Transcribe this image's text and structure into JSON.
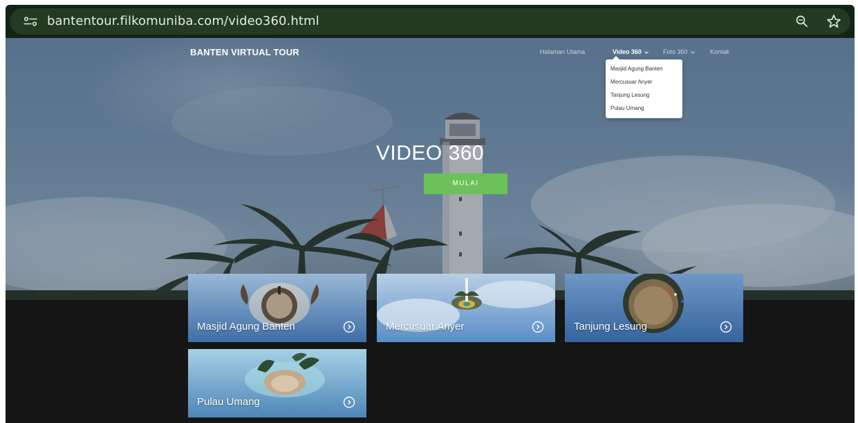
{
  "browser": {
    "url": "bantentour.filkomuniba.com/video360.html",
    "icons": [
      "site-settings-icon",
      "zoom-out-icon",
      "bookmark-star-icon"
    ]
  },
  "navbar": {
    "brand": "BANTEN VIRTUAL TOUR",
    "items": [
      {
        "label": "Halaman Utama"
      },
      {
        "label": "Video 360",
        "active": true,
        "has_dropdown": true
      },
      {
        "label": "Foto 360",
        "has_dropdown": true
      },
      {
        "label": "Kontak"
      }
    ]
  },
  "dropdown": {
    "items": [
      "Masjid Agung Banten",
      "Mercusuar Anyer",
      "Tanjung Lesung",
      "Pulau Umang"
    ]
  },
  "hero": {
    "title": "VIDEO 360",
    "button": "MULAI"
  },
  "cards": [
    {
      "label": "Masjid Agung Banten",
      "icon": "play-circle-icon"
    },
    {
      "label": "Mercusuar Anyer",
      "icon": "play-circle-icon"
    },
    {
      "label": "Tanjung Lesung",
      "icon": "play-circle-icon"
    },
    {
      "label": "Pulau Umang",
      "icon": "play-circle-icon"
    }
  ],
  "colors": {
    "browser_bar": "#122414",
    "url_pill": "#243a22",
    "cta": "#6cc158",
    "page_bg": "#151515"
  }
}
